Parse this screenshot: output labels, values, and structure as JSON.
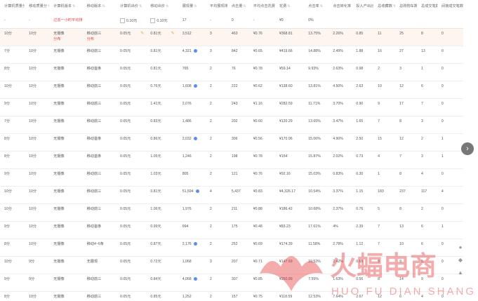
{
  "table": {
    "columns": [
      "计算机质量分",
      "移动质量分",
      "计算机版本",
      "移动版本",
      "计算机出价",
      "移动出价",
      "展现量",
      "平均展现排名",
      "点击量",
      "平均点击花费",
      "花费",
      "点击率",
      "点击转化率",
      "投入产出比",
      "总收藏数",
      "总购物车数",
      "总成交笔数",
      "间接成交笔数"
    ],
    "hint_row": [
      "-",
      "-",
      "过去一小时平均排名(10:00~11:00)",
      "",
      "0.10元",
      "0.10元",
      "17",
      "-",
      "0",
      "-",
      "¥0",
      "0%",
      "",
      "",
      "",
      "",
      "",
      ""
    ],
    "rows": [
      {
        "c1": "10分",
        "c2": "10分",
        "c3": "无摄像",
        "c3b": "分布",
        "c4": "移动前三",
        "c4b": "分布",
        "c5": "0.05元",
        "c6": "0.81元",
        "c7": "3,512",
        "c8": "3",
        "c9": "463",
        "c10": "¥0.76",
        "c11": "¥368.81",
        "c12": "13.75%",
        "c13": "2.26%",
        "c14": "0.85",
        "c15": "11",
        "c16": "25",
        "c17": "8",
        "c18": "0"
      },
      {
        "c1": "7分",
        "c2": "10分",
        "c3": "无摄像",
        "c3b": "",
        "c4": "移动前三",
        "c4b": "",
        "c5": "0.05元",
        "c6": "0.81元",
        "c7": "4,321",
        "c8": "3",
        "c9": "842",
        "c10": "¥0.65",
        "c11": "¥419.66",
        "c12": "14.88%",
        "c13": "2.49%",
        "c14": "1.88",
        "c15": "16",
        "c16": "27",
        "c17": "13",
        "c18": "0"
      },
      {
        "c1": "8分",
        "c2": "10分",
        "c3": "无摄像",
        "c3b": "",
        "c4": "移动首条",
        "c4b": "",
        "c5": "0.05元",
        "c6": "0.81元",
        "c7": "765",
        "c8": "2",
        "c9": "76",
        "c10": "¥0.78",
        "c11": "¥59.14",
        "c12": "9.93%",
        "c13": "2.63%",
        "c14": "0.98",
        "c15": "2",
        "c16": "3",
        "c17": "1",
        "c18": "0"
      },
      {
        "c1": "10分",
        "c2": "10分",
        "c3": "无摄像",
        "c3b": "",
        "c4": "移动前三",
        "c4b": "",
        "c5": "0.05元",
        "c6": "0.76元",
        "c7": "1,608",
        "c8": "2",
        "c9": "222",
        "c10": "¥0.62",
        "c11": "¥138.60",
        "c12": "13.81%",
        "c13": "4.50%",
        "c14": "2.63",
        "c15": "10",
        "c16": "12",
        "c17": "6",
        "c18": "0"
      },
      {
        "c1": "9分",
        "c2": "10分",
        "c3": "无摄像",
        "c3b": "",
        "c4": "移动前三",
        "c4b": "",
        "c5": "0.05元",
        "c6": "1.41元",
        "c7": "2,076",
        "c8": "2",
        "c9": "243",
        "c10": "¥1.16",
        "c11": "¥282.59",
        "c12": "11.71%",
        "c13": "3.70%",
        "c14": "0.90",
        "c15": "9",
        "c16": "17",
        "c17": "7",
        "c18": "0"
      },
      {
        "c1": "7分",
        "c2": "10分",
        "c3": "无摄像",
        "c3b": "",
        "c4": "移动前三",
        "c4b": "",
        "c5": "0.05元",
        "c6": "0.83元",
        "c7": "1,486",
        "c8": "2",
        "c9": "202",
        "c10": "¥0.60",
        "c11": "¥120.29",
        "c12": "13.65%",
        "c13": "3.47%",
        "c14": "1.65",
        "c15": "7",
        "c16": "8",
        "c17": "3",
        "c18": "0"
      },
      {
        "c1": "8分",
        "c2": "10分",
        "c3": "无摄像",
        "c3b": "",
        "c4": "移动首条",
        "c4b": "",
        "c5": "0.05元",
        "c6": "0.86元",
        "c7": "2,032",
        "c8": "2",
        "c9": "306",
        "c10": "¥0.56",
        "c11": "¥170.96",
        "c12": "15.06%",
        "c13": "4.90%",
        "c14": "2.50",
        "c15": "15",
        "c16": "12",
        "c17": "2",
        "c18": "1"
      },
      {
        "c1": "8分",
        "c2": "10分",
        "c3": "无摄像",
        "c3b": "",
        "c4": "移动首条",
        "c4b": "",
        "c5": "0.05元",
        "c6": "1.05元",
        "c7": "1,246",
        "c8": "2",
        "c9": "198",
        "c10": "¥0.78",
        "c11": "¥154",
        "c12": "15.87%",
        "c13": "2.02%",
        "c14": "0.73",
        "c15": "4",
        "c16": "7",
        "c17": "3",
        "c18": "1"
      },
      {
        "c1": "9分",
        "c2": "10分",
        "c3": "无摄像",
        "c3b": "",
        "c4": "移动前三",
        "c4b": "",
        "c5": "0.05元",
        "c6": "1.03元",
        "c7": "805",
        "c8": "2",
        "c9": "121",
        "c10": "¥0.76",
        "c11": "¥92.16",
        "c12": "15.03%",
        "c13": "0.83%",
        "c14": "0.30",
        "c15": "1",
        "c16": "8",
        "c17": "4",
        "c18": "0"
      },
      {
        "c1": "10分",
        "c2": "10分",
        "c3": "无摄像",
        "c3b": "",
        "c4": "移动前三",
        "c4b": "",
        "c5": "0.05元",
        "c6": "0.81元",
        "c7": "51,594",
        "c8": "4",
        "c9": "5,437",
        "c10": "¥0.83",
        "c11": "¥4,326.17",
        "c12": "10.54%",
        "c13": "3.37%",
        "c14": "1.15",
        "c15": "183",
        "c16": "237",
        "c17": "117",
        "c18": "4"
      },
      {
        "c1": "10分",
        "c2": "10分",
        "c3": "无摄像",
        "c3b": "",
        "c4": "移动前三",
        "c4b": "",
        "c5": "0.05元",
        "c6": "1.06元",
        "c7": "1,976",
        "c8": "2",
        "c9": "211",
        "c10": "¥0.88",
        "c11": "¥186.42",
        "c12": "10.68%",
        "c13": "2.37%",
        "c14": "0.76",
        "c15": "5",
        "c16": "8",
        "c17": "2",
        "c18": "0"
      },
      {
        "c1": "9分",
        "c2": "10分",
        "c3": "无摄像",
        "c3b": "",
        "c4": "移动首条",
        "c4b": "",
        "c5": "0.05元",
        "c6": "0.99元",
        "c7": "994",
        "c8": "2",
        "c9": "175",
        "c10": "¥0.48",
        "c11": "¥83.23",
        "c12": "17.61%",
        "c13": "4%",
        "c14": "2.39",
        "c15": "7",
        "c16": "13",
        "c17": "6",
        "c18": "1"
      },
      {
        "c1": "8分",
        "c2": "10分",
        "c3": "无摄像",
        "c3b": "",
        "c4": "移动4~6条",
        "c4b": "",
        "c5": "0.05元",
        "c6": "0.87元",
        "c7": "2,176",
        "c8": "2",
        "c9": "252",
        "c10": "¥0.69",
        "c11": "¥174.39",
        "c12": "11.58%",
        "c13": "2.78%",
        "c14": "1.12",
        "c15": "7",
        "c16": "10",
        "c17": "6",
        "c18": "0"
      },
      {
        "c1": "10分",
        "c2": "9分",
        "c3": "无摄像",
        "c3b": "",
        "c4": "无展现",
        "c4b": "",
        "c5": "0.05元",
        "c6": "0.72元",
        "c7": "1,068",
        "c8": "3",
        "c9": "207",
        "c10": "¥0.71",
        "c11": "¥147.69",
        "c12": "19.52%",
        "c13": "2.42%",
        "c14": "0.65",
        "c15": "5",
        "c16": "9",
        "c17": "5",
        "c18": "0"
      },
      {
        "c1": "9分",
        "c2": "9分",
        "c3": "无摄像",
        "c3b": "",
        "c4": "移动前三",
        "c4b": "",
        "c5": "0.05元",
        "c6": "0.84元",
        "c7": "4,068",
        "c8": "2",
        "c9": "307",
        "c10": "¥0.85",
        "c11": "¥260.89",
        "c12": "7.55%",
        "c13": "1.63%",
        "c14": "0.56",
        "c15": "8",
        "c16": "14",
        "c17": "9",
        "c18": "0"
      },
      {
        "c1": "8分",
        "c2": "10分",
        "c3": "无摄像",
        "c3b": "",
        "c4": "移动前三",
        "c4b": "",
        "c5": "0.05元",
        "c6": "0.85元",
        "c7": "1,252",
        "c8": "2",
        "c9": "157",
        "c10": "¥0.75",
        "c11": "¥118.59",
        "c12": "12.53%",
        "c13": "7.64%",
        "c14": "2.67",
        "c15": "12",
        "c16": "6",
        "c17": "4",
        "c18": "0"
      }
    ]
  },
  "watermark": {
    "brand": "火蝠电商",
    "pinyin": "HUO FU DIAN SHANG",
    "color": "#e4393c"
  },
  "icons": {
    "next": "chevron-right-icon",
    "edit": "pencil-icon",
    "trend": "trend-icon"
  }
}
